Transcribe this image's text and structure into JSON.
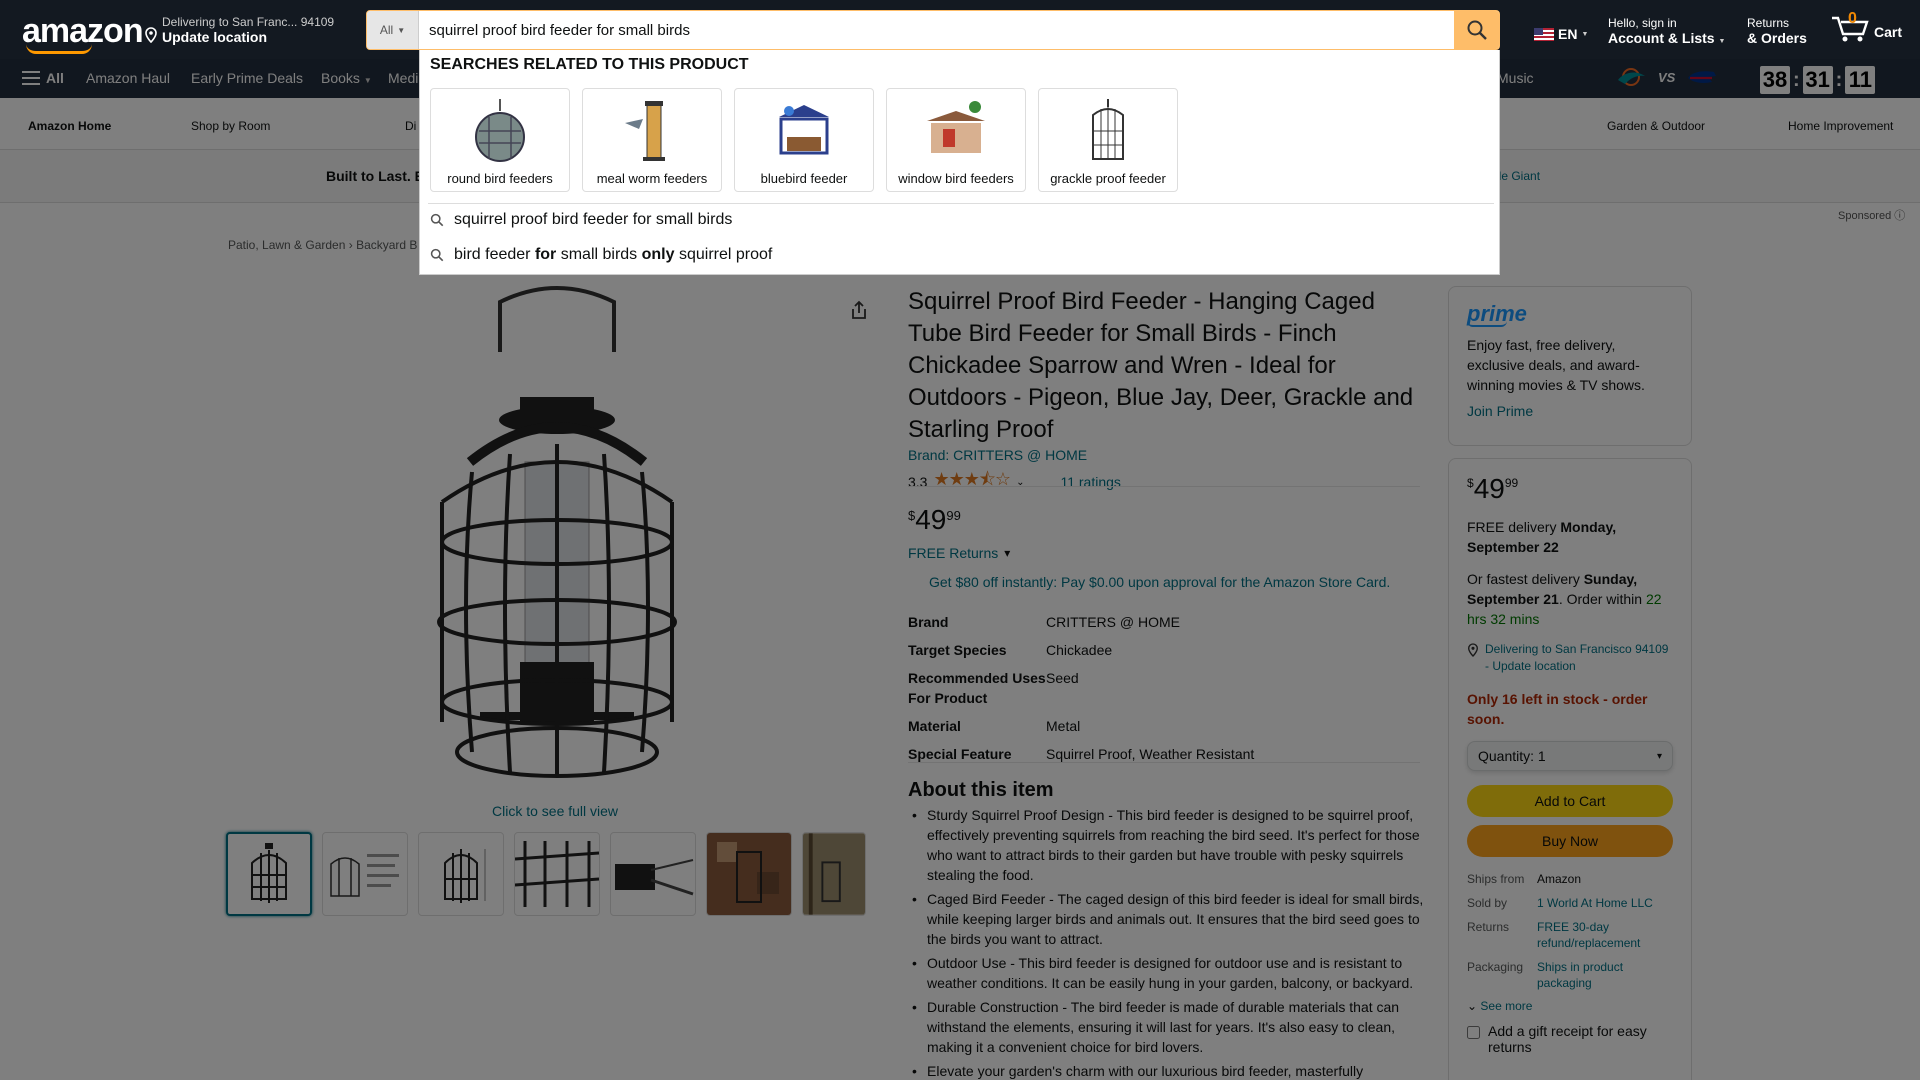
{
  "header": {
    "logo": "amazon",
    "deliver_line1": "Delivering to San Franc... 94109",
    "deliver_line2": "Update location",
    "search_category": "All",
    "search_value": "squirrel proof bird feeder for small birds",
    "language": "EN",
    "account_line1": "Hello, sign in",
    "account_line2": "Account & Lists",
    "returns_line1": "Returns",
    "returns_line2": "& Orders",
    "cart_count": "0",
    "cart_label": "Cart"
  },
  "nav": {
    "all": "All",
    "items": [
      "Amazon Haul",
      "Early Prime Deals",
      "Books",
      "Medi"
    ],
    "music": "Music",
    "vs": "VS",
    "countdown": [
      "38",
      "31",
      "11"
    ]
  },
  "subnav": {
    "items": [
      "Amazon Home",
      "Shop by Room",
      "Di",
      "Garden & Outdoor",
      "Home Improvement"
    ]
  },
  "banner": {
    "left_text": "Built to Last. E",
    "right_text": "ttle Giant",
    "sponsored": "Sponsored"
  },
  "breadcrumb": "Patio, Lawn & Garden  ›  Backyard B",
  "dropdown": {
    "title": "SEARCHES RELATED TO THIS PRODUCT",
    "cards": [
      "round bird feeders",
      "meal worm feeders",
      "bluebird feeder",
      "window bird feeders",
      "grackle proof feeder"
    ],
    "suggestion1": "squirrel proof bird feeder for small birds",
    "suggestion2_a": "bird feeder ",
    "suggestion2_b": "for",
    "suggestion2_c": " small birds ",
    "suggestion2_d": "only",
    "suggestion2_e": " squirrel proof"
  },
  "product": {
    "see_full": "Click to see full view",
    "title": "Squirrel Proof Bird Feeder - Hanging Caged Tube Bird Feeder for Small Birds - Finch Chickadee Sparrow and Wren - Ideal for Outdoors - Pigeon, Blue Jay, Deer, Grackle and Starling Proof",
    "brand": "Brand: CRITTERS @ HOME",
    "rating": "3.3",
    "stars": "★★★⯪☆",
    "ratings_count": "11 ratings",
    "price_symbol": "$",
    "price_whole": "49",
    "price_frac": "99",
    "free_returns": "FREE Returns",
    "store_card": "Get $80 off instantly: Pay $0.00 upon approval for the Amazon Store Card.",
    "specs": [
      {
        "k": "Brand",
        "v": "CRITTERS @ HOME"
      },
      {
        "k": "Target Species",
        "v": "Chickadee"
      },
      {
        "k": "Recommended Uses For Product",
        "v": "Seed"
      },
      {
        "k": "Material",
        "v": "Metal"
      },
      {
        "k": "Special Feature",
        "v": "Squirrel Proof, Weather Resistant"
      }
    ],
    "about_title": "About this item",
    "about": [
      "Sturdy Squirrel Proof Design - This bird feeder is designed to be squirrel proof, effectively preventing squirrels from reaching the bird seed. It's perfect for those who want to attract birds to their garden but have trouble with pesky squirrels stealing the food.",
      "Caged Bird Feeder - The caged design of this bird feeder is ideal for small birds, while keeping larger birds and animals out. It ensures that the bird seed goes to the birds you want to attract.",
      "Outdoor Use - This bird feeder is designed for outdoor use and is resistant to weather conditions. It can be easily hung in your garden, balcony, or backyard.",
      "Durable Construction - The bird feeder is made of durable materials that can withstand the elements, ensuring it will last for years. It's also easy to clean, making it a convenient choice for bird lovers.",
      "Elevate your garden's charm with our luxurious bird feeder, masterfully"
    ]
  },
  "prime": {
    "logo": "prime",
    "text": "Enjoy fast, free delivery, exclusive deals, and award-winning movies & TV shows.",
    "join": "Join Prime"
  },
  "buybox": {
    "price_symbol": "$",
    "price_whole": "49",
    "price_frac": "99",
    "delivery_a": "FREE delivery ",
    "delivery_b": "Monday, September 22",
    "fastest_a": "Or fastest delivery ",
    "fastest_b": "Sunday, September 21",
    "fastest_c": ". Order within ",
    "fastest_d": "22 hrs 32 mins",
    "location": "Delivering to San Francisco 94109 - Update location",
    "stock": "Only 16 left in stock - order soon.",
    "quantity": "Quantity:  1",
    "add_to_cart": "Add to Cart",
    "buy_now": "Buy Now",
    "meta": [
      {
        "k": "Ships from",
        "v": "Amazon",
        "plain": true
      },
      {
        "k": "Sold by",
        "v": "1 World At Home LLC",
        "plain": false
      },
      {
        "k": "Returns",
        "v": "FREE 30-day refund/replacement",
        "plain": false
      },
      {
        "k": "Packaging",
        "v": "Ships in product packaging",
        "plain": false
      }
    ],
    "see_more": "See more",
    "gift": "Add a gift receipt for easy returns"
  },
  "colors": {
    "header_bg": "#131921",
    "nav_bg": "#232f3e",
    "accent": "#febd69",
    "link": "#007185",
    "add_to_cart": "#ffd814",
    "buy_now": "#ffa41c",
    "stock_red": "#b12704"
  }
}
